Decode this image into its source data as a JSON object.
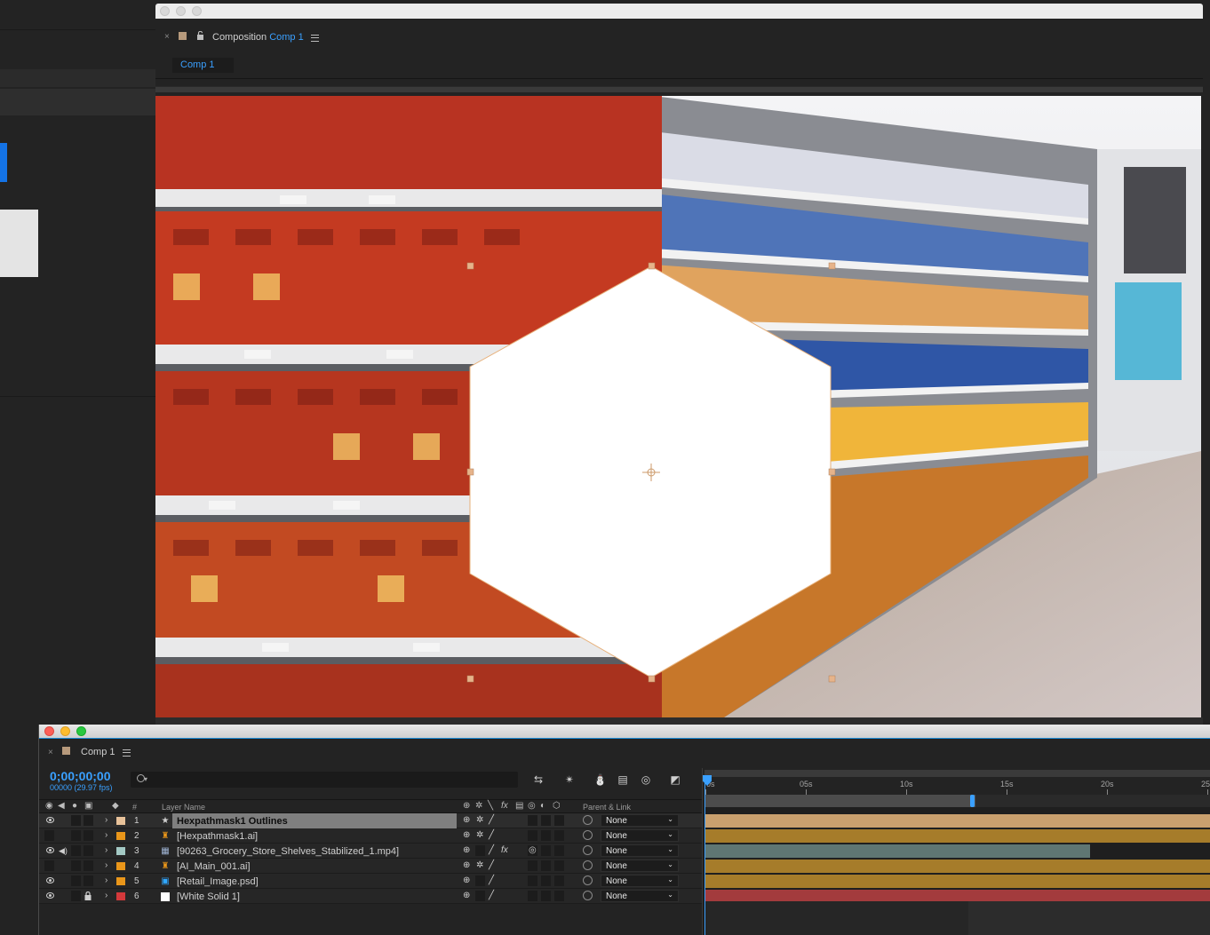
{
  "composition_panel": {
    "title_prefix": "Composition",
    "title_comp": "Comp 1",
    "flow_tab": "Comp 1"
  },
  "timeline": {
    "tab_label": "Comp 1",
    "timecode": "0;00;00;00",
    "frame_info": "00000 (29.97 fps)",
    "search_placeholder": "",
    "headers": {
      "number": "#",
      "layer_name": "Layer Name",
      "parent_link": "Parent & Link"
    },
    "ruler_labels": [
      "0s",
      "05s",
      "10s",
      "15s",
      "20s",
      "25"
    ],
    "layers": [
      {
        "num": "1",
        "name": "Hexpathmask1 Outlines",
        "label_color": "#e8c29a",
        "icon": "star-shape-icon",
        "parent": "None",
        "visible": true,
        "selected": true
      },
      {
        "num": "2",
        "name": "[Hexpathmask1.ai]",
        "label_color": "#e9961a",
        "icon": "illustrator-file-icon",
        "parent": "None",
        "visible": false,
        "selected": false
      },
      {
        "num": "3",
        "name": "[90263_Grocery_Store_Shelves_Stabilized_1.mp4]",
        "label_color": "#a3c9c4",
        "icon": "footage-file-icon",
        "parent": "None",
        "visible": true,
        "selected": false
      },
      {
        "num": "4",
        "name": "[AI_Main_001.ai]",
        "label_color": "#e9961a",
        "icon": "illustrator-file-icon",
        "parent": "None",
        "visible": false,
        "selected": false
      },
      {
        "num": "5",
        "name": "[Retail_Image.psd]",
        "label_color": "#e9961a",
        "icon": "photoshop-file-icon",
        "parent": "None",
        "visible": true,
        "selected": false
      },
      {
        "num": "6",
        "name": "[White Solid 1]",
        "label_color": "#d4393b",
        "icon": "solid-swatch-icon",
        "parent": "None",
        "visible": true,
        "selected": false
      }
    ],
    "bar_colors": [
      "#c9a06e",
      "#a67c2a",
      "#5f7673",
      "#a67c2a",
      "#a67c2a",
      "#a33b3d"
    ]
  }
}
